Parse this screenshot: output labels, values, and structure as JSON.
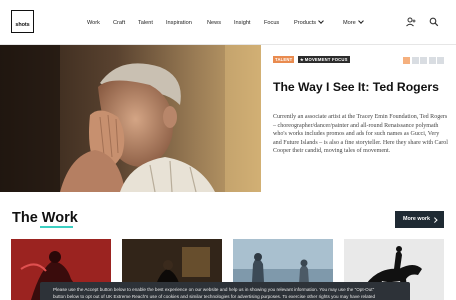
{
  "header": {
    "logo_text": "shots",
    "nav": [
      {
        "label": "Work"
      },
      {
        "label": "Craft"
      },
      {
        "label": "Talent"
      },
      {
        "label": "Inspiration"
      },
      {
        "label": "News"
      },
      {
        "label": "Insight"
      },
      {
        "label": "Focus"
      },
      {
        "label": "Products"
      },
      {
        "label": "More"
      }
    ],
    "icons": [
      "user-icon",
      "search-icon"
    ]
  },
  "hero": {
    "tags": [
      "TALENT",
      "MOVEMENT FOCUS"
    ],
    "slide_count": 5,
    "active_slide": 1,
    "title": "The Way I See It: Ted Rogers",
    "body": "Currently an associate artist at the Tracey Emin Foundation, Ted Rogers – choreographer/dancer/painter and all-round Renaissance polymath who's works includes promos and ads for such names as Gucci, Very and Future Islands – is also a fine storyteller. Here they share with Carol Cooper their candid, moving tales of movement."
  },
  "work": {
    "title": "The Work",
    "more_label": "More work",
    "accent_color": "#3ccfc2",
    "thumbnails": [
      "thumb-red-figure",
      "thumb-dark-scene",
      "thumb-blue-figures",
      "thumb-horse-rider"
    ]
  },
  "cookie": {
    "line1": "Please use the Accept button below to enable the best experience on our website and help us in showing you relevant information. You may use the \"Opt-Out\"",
    "line2": "button below to opt out of UK Extreme Reach's use of cookies and similar technologies for advertising purposes. To exercise other rights you may have related"
  },
  "colors": {
    "tag_talent": "#e98b4f",
    "tag_focus": "#2c2c2c",
    "button": "#1f2a33"
  }
}
